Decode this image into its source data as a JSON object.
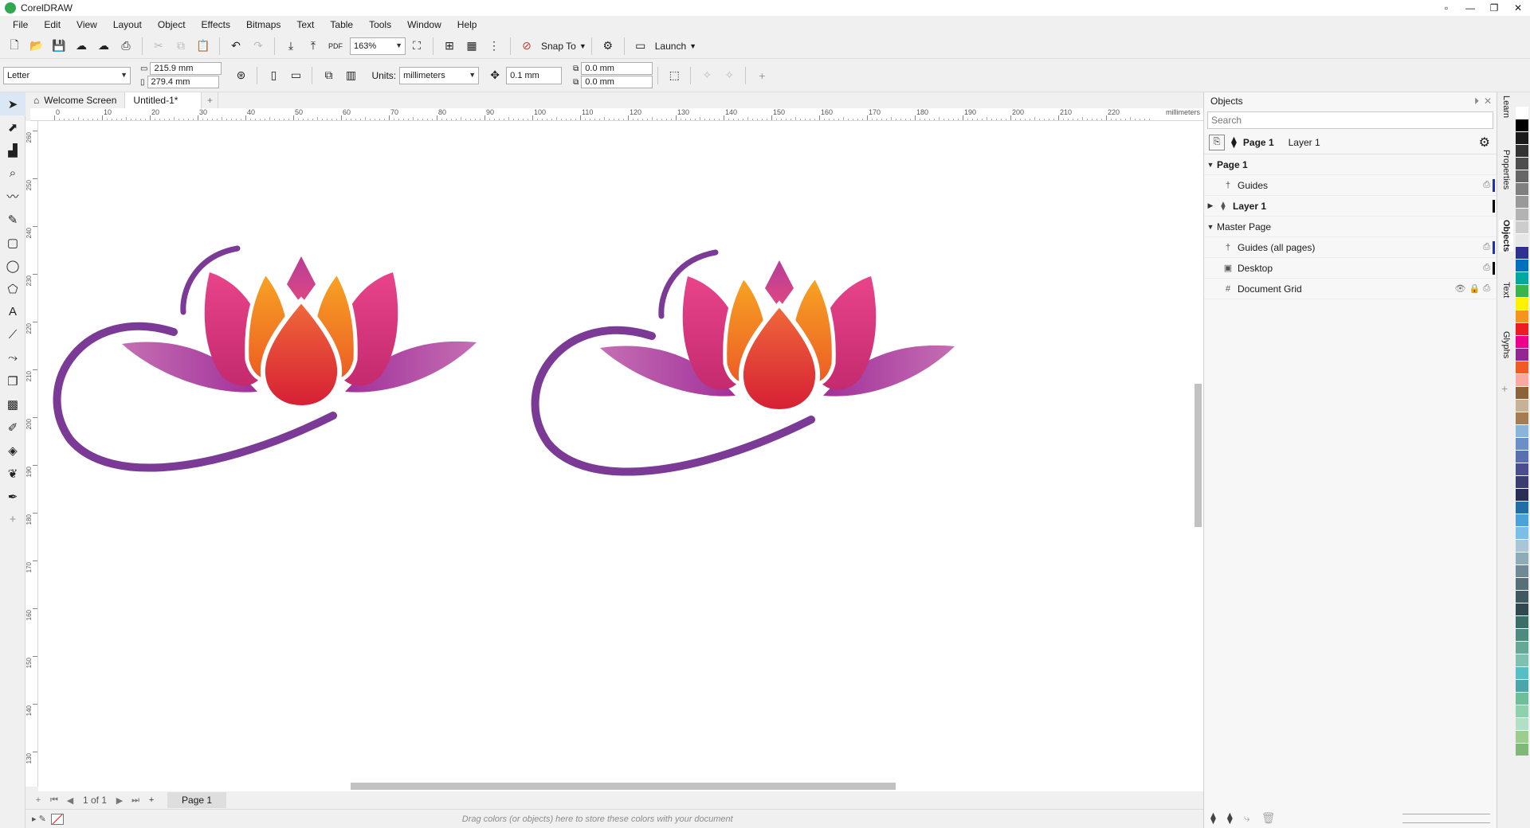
{
  "window": {
    "title": "CorelDRAW"
  },
  "menu": [
    "File",
    "Edit",
    "View",
    "Layout",
    "Object",
    "Effects",
    "Bitmaps",
    "Text",
    "Table",
    "Tools",
    "Window",
    "Help"
  ],
  "toolbar": {
    "zoom": "163%",
    "snap_to": "Snap To",
    "launch": "Launch"
  },
  "property_bar": {
    "page_size": "Letter",
    "width": "215.9 mm",
    "height": "279.4 mm",
    "units_label": "Units:",
    "units": "millimeters",
    "nudge": "0.1 mm",
    "dup_x": "0.0 mm",
    "dup_y": "0.0 mm"
  },
  "tabs": {
    "welcome": "Welcome Screen",
    "doc": "Untitled-1*",
    "add": "+"
  },
  "ruler": {
    "unit": "millimeters",
    "h_ticks": [
      "0",
      "10",
      "20",
      "30",
      "40",
      "50",
      "60",
      "70",
      "80",
      "90",
      "100",
      "110",
      "120",
      "130",
      "140",
      "150",
      "160",
      "170",
      "180",
      "190",
      "200",
      "210",
      "220"
    ],
    "v_ticks": [
      "260",
      "250",
      "240",
      "230",
      "220",
      "210",
      "200",
      "190",
      "180",
      "170",
      "160",
      "150",
      "140",
      "130"
    ]
  },
  "page_nav": {
    "count": "1 of 1",
    "page_tab": "Page 1"
  },
  "status": {
    "hint": "Drag colors (or objects) here to store these colors with your document"
  },
  "objects_panel": {
    "title": "Objects",
    "search_placeholder": "Search",
    "current_page": "Page 1",
    "current_layer": "Layer 1",
    "rows": [
      {
        "label": "Page 1",
        "bold": true,
        "level": 0,
        "expanded": true
      },
      {
        "label": "Guides",
        "bold": false,
        "level": 1
      },
      {
        "label": "Layer 1",
        "bold": true,
        "level": 1,
        "collapsed": true
      },
      {
        "label": "Master Page",
        "bold": false,
        "level": 0,
        "expanded": true
      },
      {
        "label": "Guides (all pages)",
        "bold": false,
        "level": 1
      },
      {
        "label": "Desktop",
        "bold": false,
        "level": 1
      },
      {
        "label": "Document Grid",
        "bold": false,
        "level": 1
      }
    ]
  },
  "side_tabs": [
    "Learn",
    "Properties",
    "Objects",
    "Text",
    "Glyphs"
  ],
  "palette": [
    "#ffffff",
    "#000000",
    "#1a1a1a",
    "#333333",
    "#4d4d4d",
    "#666666",
    "#808080",
    "#999999",
    "#b3b3b3",
    "#cccccc",
    "#e6e6e6",
    "#2e3192",
    "#0071bc",
    "#00a99d",
    "#39b54a",
    "#fff200",
    "#f7941d",
    "#ed1c24",
    "#ec008c",
    "#92278f",
    "#f15a24",
    "#f9a99f",
    "#8c6239",
    "#c7b299",
    "#a67c52",
    "#8ab4d9",
    "#6d8ec7",
    "#5a6fb0",
    "#4a4e8f",
    "#3b3d70",
    "#2b2d55",
    "#1d6fa5",
    "#4aa3d8",
    "#7bbfe6",
    "#a7c7d9",
    "#8eabb8",
    "#6f8a96",
    "#557079",
    "#3f5960",
    "#2f4a4f",
    "#3b6e66",
    "#4f8a7d",
    "#66a896",
    "#7fc0b0",
    "#55bfc4",
    "#4aa6a8",
    "#6cbf9a",
    "#8fd1ac",
    "#b3e0c4",
    "#9ccc8f",
    "#7fb879"
  ],
  "colors": {
    "lotus_purple": "#7b3a95",
    "lotus_magenta": "#d63a7a",
    "lotus_orange": "#f08a1c",
    "lotus_red": "#e22b3a",
    "accent": "#1a4b8c"
  }
}
